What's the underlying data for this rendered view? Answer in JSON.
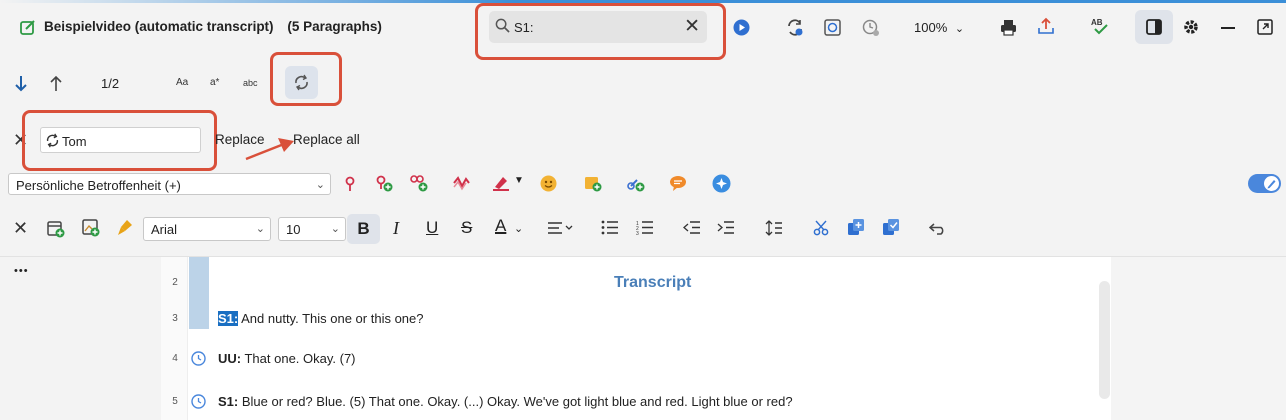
{
  "header": {
    "title": "Beispielvideo (automatic transcript)",
    "paragraphs": "(5 Paragraphs)",
    "zoom": "100%"
  },
  "search": {
    "value": "S1:",
    "clear_label": "✕"
  },
  "nav": {
    "counter": "1/2",
    "opt_case": "Aa",
    "opt_regex": "a*",
    "opt_word": "abc"
  },
  "replace": {
    "value": "Tom",
    "replace_label": "Replace",
    "replace_all_label": "Replace all"
  },
  "code_select": {
    "value": "Persönliche Betroffenheit (+)"
  },
  "format": {
    "font": "Arial",
    "size": "10",
    "bold": "B",
    "italic": "I",
    "underline": "U",
    "strike": "S",
    "color": "A"
  },
  "left_panel": {
    "more": "•••"
  },
  "document": {
    "heading": "Transcript",
    "heading_line": "2",
    "lines": [
      {
        "num": "3",
        "speaker": "S1:",
        "text": " And nutty. This one or this one?",
        "highlight": true,
        "clock": false
      },
      {
        "num": "4",
        "speaker": "UU:",
        "text": " That one. Okay. (7)",
        "highlight": false,
        "clock": true
      },
      {
        "num": "5",
        "speaker": "S1:",
        "text": " Blue or red? Blue. (5) That one. Okay. (...) Okay. We've got light blue and red. Light blue or red?",
        "highlight": false,
        "clock": true
      }
    ]
  },
  "colors": {
    "accent": "#1a6fc2",
    "annotation_red": "#d9503a",
    "heading_blue": "#4a7fb8"
  }
}
